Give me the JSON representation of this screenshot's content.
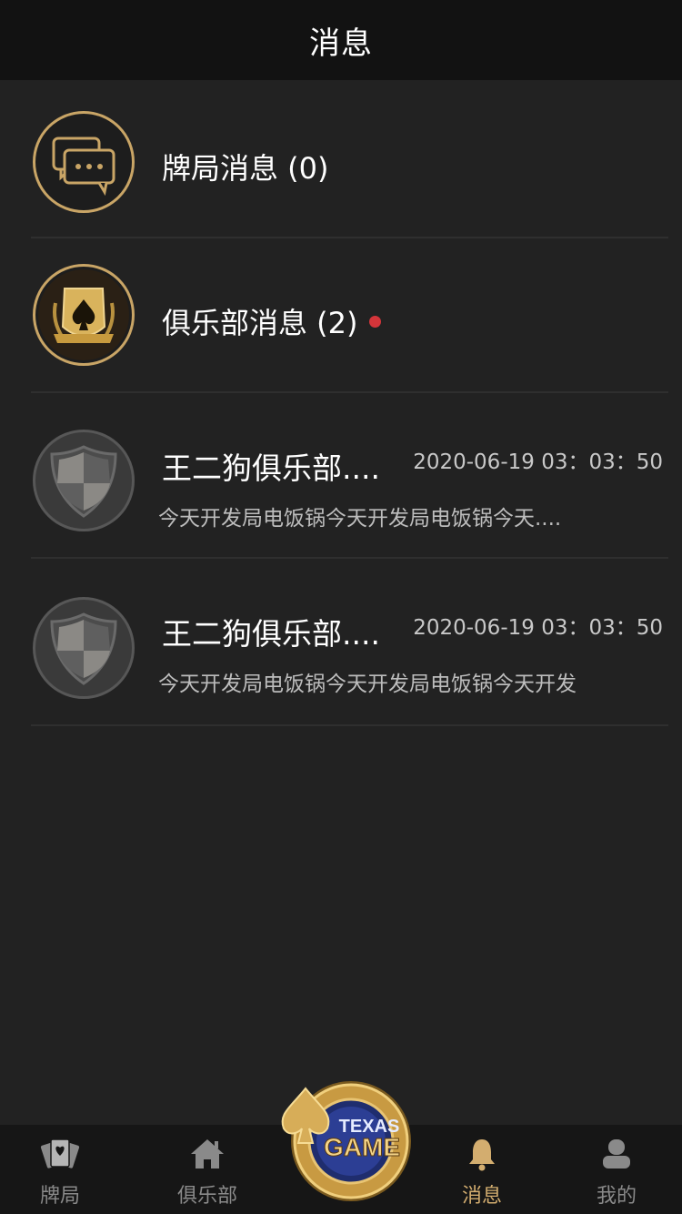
{
  "header": {
    "title": "消息"
  },
  "categories": [
    {
      "label": "牌局消息 (0)",
      "icon": "chat-bubbles-icon",
      "unread": false
    },
    {
      "label": "俱乐部消息 (2)",
      "icon": "club-spade-crest-icon",
      "unread": true
    }
  ],
  "messages": [
    {
      "title": "王二狗俱乐部....",
      "time": "2020-06-19 03：03：50",
      "text": "今天开发局电饭锅今天开发局电饭锅今天....",
      "icon": "shield-icon"
    },
    {
      "title": "王二狗俱乐部....",
      "time": "2020-06-19 03：03：50",
      "text": "今天开发局电饭锅今天开发局电饭锅今天开发",
      "icon": "shield-icon"
    }
  ],
  "tabbar": {
    "tabs": [
      {
        "label": "牌局",
        "icon": "cards-icon",
        "active": false
      },
      {
        "label": "俱乐部",
        "icon": "home-icon",
        "active": false
      },
      {
        "label": "消息",
        "icon": "bell-icon",
        "active": true
      },
      {
        "label": "我的",
        "icon": "user-icon",
        "active": false
      }
    ],
    "center_logo": {
      "line1": "TEXAS",
      "line2": "GAME"
    }
  },
  "colors": {
    "accent_gold": "#d3ad6f",
    "unread_dot": "#d4353a",
    "background": "#222222",
    "topbar": "#121212"
  }
}
